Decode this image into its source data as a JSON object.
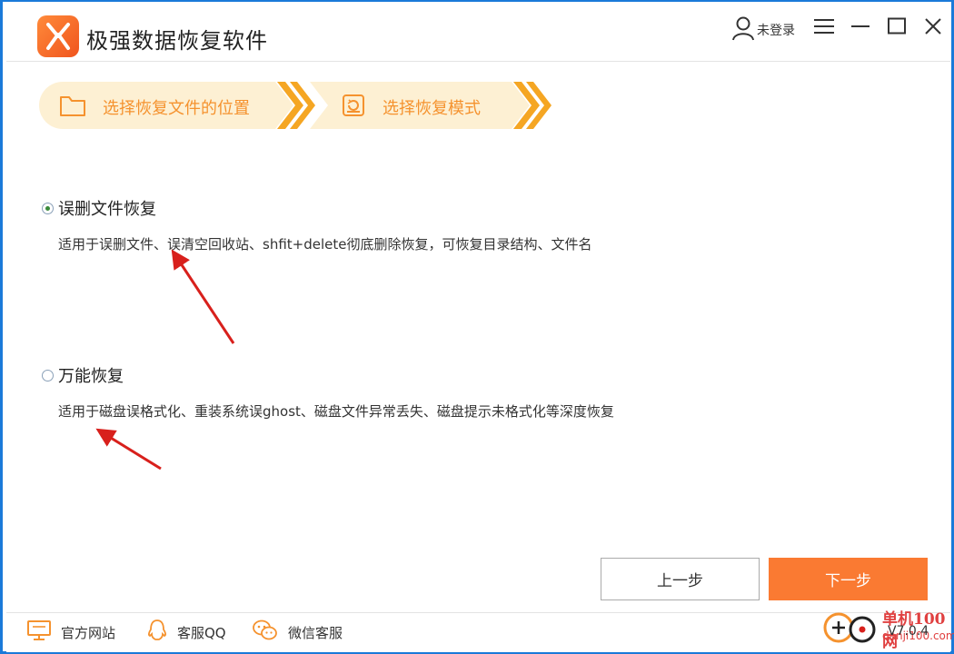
{
  "app": {
    "title": "极强数据恢复软件",
    "user_label": "未登录",
    "accent_color": "#fa7a32"
  },
  "steps": [
    {
      "label": "选择恢复文件的位置",
      "icon": "folder-icon"
    },
    {
      "label": "选择恢复模式",
      "icon": "restore-icon"
    }
  ],
  "options": [
    {
      "title": "误删文件恢复",
      "description": "适用于误删文件、误清空回收站、shfit+delete彻底删除恢复，可恢复目录结构、文件名",
      "selected": true
    },
    {
      "title": "万能恢复",
      "description": "适用于磁盘误格式化、重装系统误ghost、磁盘文件异常丢失、磁盘提示未格式化等深度恢复",
      "selected": false
    }
  ],
  "buttons": {
    "prev_label": "上一步",
    "next_label": "下一步"
  },
  "footer": {
    "items": [
      {
        "label": "官方网站",
        "icon": "monitor-icon"
      },
      {
        "label": "客服QQ",
        "icon": "qq-icon"
      },
      {
        "label": "微信客服",
        "icon": "wechat-icon"
      }
    ],
    "version": "V7.0.4",
    "watermark_text": "单机100网",
    "watermark_url": "danji100.com"
  }
}
